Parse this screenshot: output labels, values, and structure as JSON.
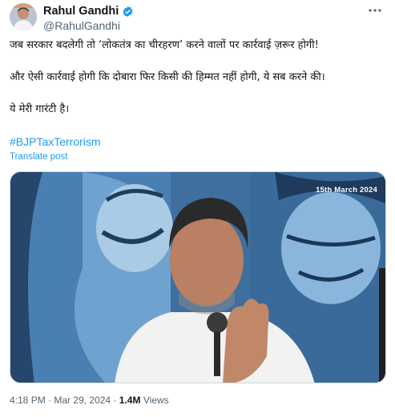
{
  "author": {
    "display_name": "Rahul Gandhi",
    "handle": "@RahulGandhi",
    "verified": true
  },
  "tweet": {
    "paragraphs": [
      "जब सरकार बदलेगी तो ‘लोकतंत्र का चीरहरण’ करने वालों पर कार्रवाई ज़रूर होगी!",
      "और ऐसी कार्रवाई होगी कि दोबारा फिर किसी की हिम्मत नहीं होगी, ये सब करने की।",
      "ये मेरी गारंटी है।"
    ],
    "hashtag": "#BJPTaxTerrorism",
    "translate_label": "Translate post"
  },
  "media": {
    "date_overlay": "15th March 2024"
  },
  "meta": {
    "time": "4:18 PM",
    "separator": "·",
    "date": "Mar 29, 2024",
    "views_count": "1.4M",
    "views_label": "Views"
  },
  "icons": {
    "verified": "verified-badge-icon",
    "more": "more-options-icon"
  },
  "colors": {
    "link": "#1d9bf0",
    "secondary_text": "#536471"
  }
}
